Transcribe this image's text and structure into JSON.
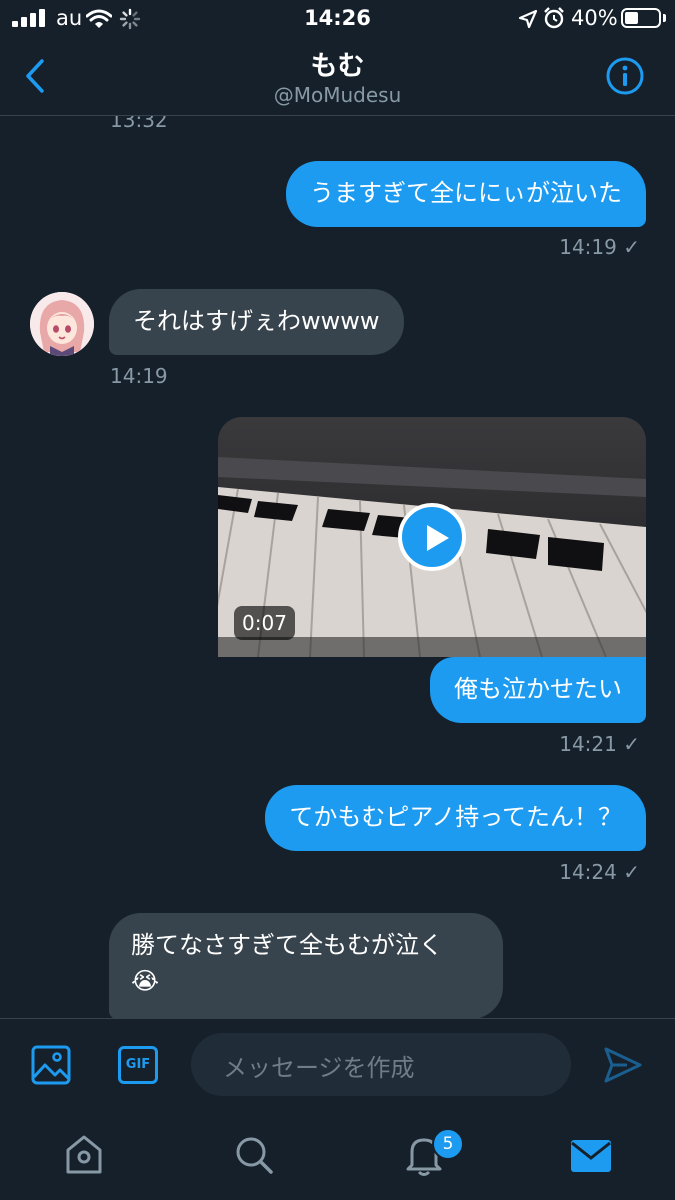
{
  "status_bar": {
    "carrier": "au",
    "time": "14:26",
    "battery_percent_label": "40%",
    "battery_level": 0.4
  },
  "header": {
    "title": "もむ",
    "handle": "@MoMudesu"
  },
  "messages": [
    {
      "type": "time_only",
      "time": "13:32"
    },
    {
      "type": "sent",
      "text": "うますぎて全ににぃが泣いた",
      "time": "14:19 ✓"
    },
    {
      "type": "received",
      "text": "それはすげぇわwwww",
      "time": "14:19"
    },
    {
      "type": "sent_video",
      "duration": "0:07",
      "caption": "俺も泣かせたい",
      "time": "14:21 ✓"
    },
    {
      "type": "sent",
      "text": "てかもむピアノ持ってたん！？",
      "time": "14:24 ✓"
    },
    {
      "type": "received",
      "text": "勝てなさすぎて全もむが泣く",
      "emoji": "😭"
    }
  ],
  "composer": {
    "placeholder": "メッセージを作成",
    "gif_label": "GIF"
  },
  "tabbar": {
    "notifications_badge": "5"
  },
  "colors": {
    "background": "#15202b",
    "accent": "#1d9bf0",
    "received_bubble": "#38444d",
    "secondary_text": "#8899a6"
  },
  "icons": [
    "signal-icon",
    "wifi-icon",
    "loading-icon",
    "location-icon",
    "alarm-icon",
    "battery-icon",
    "back-chevron-icon",
    "info-icon",
    "image-icon",
    "gif-icon",
    "send-icon",
    "home-icon",
    "search-icon",
    "bell-icon",
    "mail-icon"
  ]
}
